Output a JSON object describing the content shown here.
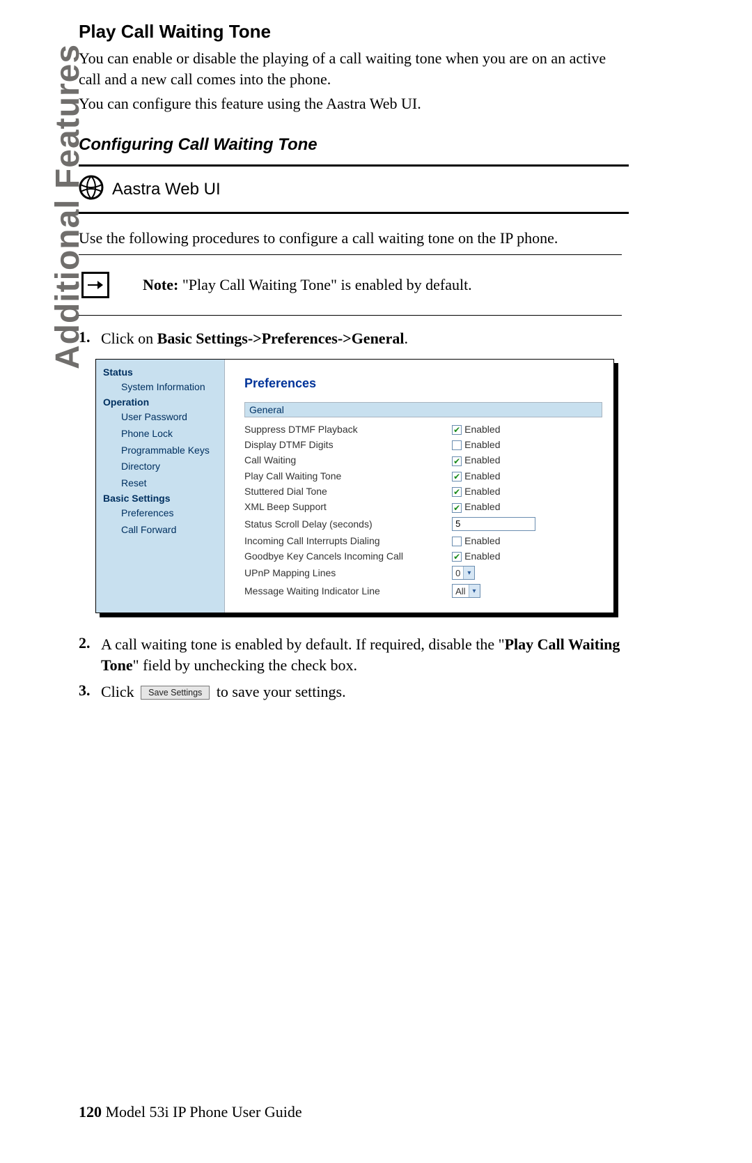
{
  "sidebar_label": "Additional Features",
  "title": "Play Call Waiting Tone",
  "para1": "You can enable or disable the playing of a call waiting tone when you are on an active call and a new call comes into the phone.",
  "para2": "You can configure this feature using the Aastra Web UI.",
  "subtitle": "Configuring Call Waiting Tone",
  "web_ui_label": "Aastra Web UI",
  "intro": "Use the following procedures to configure a call waiting tone on the IP phone.",
  "note_label": "Note:",
  "note_text": " \"Play Call Waiting Tone\" is enabled by default.",
  "steps": {
    "s1_num": "1.",
    "s1_pre": "Click on ",
    "s1_bold": "Basic Settings->Preferences->General",
    "s1_post": ".",
    "s2_num": "2.",
    "s2_pre": "A call waiting tone is enabled by default. If required, disable the \"",
    "s2_bold": "Play Call Waiting Tone",
    "s2_post": "\" field by unchecking the check box.",
    "s3_num": "3.",
    "s3_pre": "Click ",
    "s3_btn": "Save Settings",
    "s3_post": " to save your settings."
  },
  "shot": {
    "nav": {
      "status": "Status",
      "system_info": "System Information",
      "operation": "Operation",
      "user_password": "User Password",
      "phone_lock": "Phone Lock",
      "programmable_keys": "Programmable Keys",
      "directory": "Directory",
      "reset": "Reset",
      "basic_settings": "Basic Settings",
      "preferences": "Preferences",
      "call_forward": "Call Forward"
    },
    "main_title": "Preferences",
    "section": "General",
    "rows": {
      "r0": {
        "label": "Suppress DTMF Playback",
        "enabled": "Enabled",
        "checked": "✔"
      },
      "r1": {
        "label": "Display DTMF Digits",
        "enabled": "Enabled",
        "checked": ""
      },
      "r2": {
        "label": "Call Waiting",
        "enabled": "Enabled",
        "checked": "✔"
      },
      "r3": {
        "label": "Play Call Waiting Tone",
        "enabled": "Enabled",
        "checked": "✔"
      },
      "r4": {
        "label": "Stuttered Dial Tone",
        "enabled": "Enabled",
        "checked": "✔"
      },
      "r5": {
        "label": "XML Beep Support",
        "enabled": "Enabled",
        "checked": "✔"
      },
      "r6": {
        "label": "Status Scroll Delay (seconds)",
        "value": "5"
      },
      "r7": {
        "label": "Incoming Call Interrupts Dialing",
        "enabled": "Enabled",
        "checked": ""
      },
      "r8": {
        "label": "Goodbye Key Cancels Incoming Call",
        "enabled": "Enabled",
        "checked": "✔"
      },
      "r9": {
        "label": "UPnP Mapping Lines",
        "value": "0"
      },
      "r10": {
        "label": "Message Waiting Indicator Line",
        "value": "All"
      }
    }
  },
  "footer": {
    "page": "120",
    "title": " Model 53i IP Phone User Guide"
  }
}
